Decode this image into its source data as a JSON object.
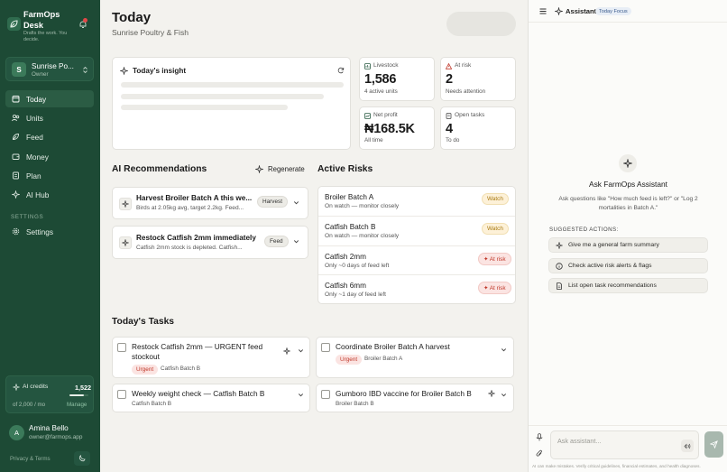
{
  "sidebar": {
    "brand": {
      "name_line1": "FarmOps",
      "name_line2": "Desk",
      "tagline_line1": "Drafts the work. You",
      "tagline_line2": "decide."
    },
    "farm": {
      "initial": "S",
      "name": "Sunrise Po...",
      "role": "Owner"
    },
    "nav": [
      {
        "label": "Today",
        "icon": "calendar-icon"
      },
      {
        "label": "Units",
        "icon": "units-icon"
      },
      {
        "label": "Feed",
        "icon": "feed-icon"
      },
      {
        "label": "Money",
        "icon": "money-icon"
      },
      {
        "label": "Plan",
        "icon": "plan-icon"
      },
      {
        "label": "AI Hub",
        "icon": "sparkle-icon"
      }
    ],
    "settings_heading": "SETTINGS",
    "settings_label": "Settings",
    "credits": {
      "label": "AI credits",
      "value": "1,522",
      "of_text": "of 2,000 / mo",
      "manage": "Manage",
      "used_fraction": 0.76
    },
    "user": {
      "initial": "A",
      "name": "Amina Bello",
      "email": "owner@farmops.app"
    },
    "privacy": "Privacy & Terms"
  },
  "header": {
    "title": "Today",
    "subtitle": "Sunrise Poultry & Fish"
  },
  "insight": {
    "title": "Today's insight"
  },
  "stats": [
    {
      "label": "Livestock",
      "value": "1,586",
      "sub": "4 active units",
      "icon": "livestock-icon"
    },
    {
      "label": "At risk",
      "value": "2",
      "sub": "Needs attention",
      "icon": "warning-icon"
    },
    {
      "label": "Net profit",
      "value": "₦168.5K",
      "sub": "All time",
      "icon": "profit-icon"
    },
    {
      "label": "Open tasks",
      "value": "4",
      "sub": "To do",
      "icon": "tasks-icon"
    }
  ],
  "recommendations": {
    "heading": "AI Recommendations",
    "regenerate": "Regenerate",
    "items": [
      {
        "title": "Harvest Broiler Batch A this we...",
        "desc": "Birds at 2.05kg avg, target 2.2kg. Feed...",
        "tag": "Harvest"
      },
      {
        "title": "Restock Catfish 2mm immediately",
        "desc": "Catfish 2mm stock is depleted. Catfish...",
        "tag": "Feed"
      }
    ]
  },
  "risks": {
    "heading": "Active Risks",
    "items": [
      {
        "name": "Broiler Batch A",
        "desc": "On watch — monitor closely",
        "badge": "Watch"
      },
      {
        "name": "Catfish Batch B",
        "desc": "On watch — monitor closely",
        "badge": "Watch"
      },
      {
        "name": "Catfish 2mm",
        "desc": "Only ~0 days of feed left",
        "badge": "✦ At risk"
      },
      {
        "name": "Catfish 6mm",
        "desc": "Only ~1 day of feed left",
        "badge": "✦ At risk"
      }
    ]
  },
  "tasks": {
    "heading": "Today's Tasks",
    "items": [
      {
        "title_line1": "Restock Catfish 2mm — URGENT feed",
        "title_line2": "stockout",
        "tag": "Urgent",
        "unit": "Catfish Batch B"
      },
      {
        "title_line1": "Coordinate Broiler Batch A harvest",
        "tag": "Urgent",
        "unit": "Broiler Batch A"
      },
      {
        "title_line1": "Weekly weight check — Catfish Batch B",
        "unit": "Catfish Batch B"
      },
      {
        "title_line1": "Gumboro IBD vaccine for Broiler Batch B",
        "unit": "Broiler Batch B"
      }
    ]
  },
  "assistant": {
    "title": "Assistant",
    "focus_badge": "Today Focus",
    "empty_title": "Ask FarmOps Assistant",
    "empty_desc_line1": "Ask questions like \"How much feed is left?\" or \"Log 2",
    "empty_desc_line2": "mortalities in Batch A.\"",
    "suggested_heading": "SUGGESTED ACTIONS:",
    "suggestions": [
      {
        "label": "Give me a general farm summary",
        "icon": "sparkle-icon"
      },
      {
        "label": "Check active risk alerts & flags",
        "icon": "info-icon"
      },
      {
        "label": "List open task recommendations",
        "icon": "document-icon"
      }
    ],
    "input_placeholder": "Ask assistant...",
    "disclaimer": "AI can make mistakes. Verify critical guidelines, financial estimates, and health diagnoses."
  },
  "colors": {
    "sidebar": "#1d4a35",
    "accent": "#2b5c44",
    "risk": "#c0392b",
    "watch": "#b8860b"
  }
}
